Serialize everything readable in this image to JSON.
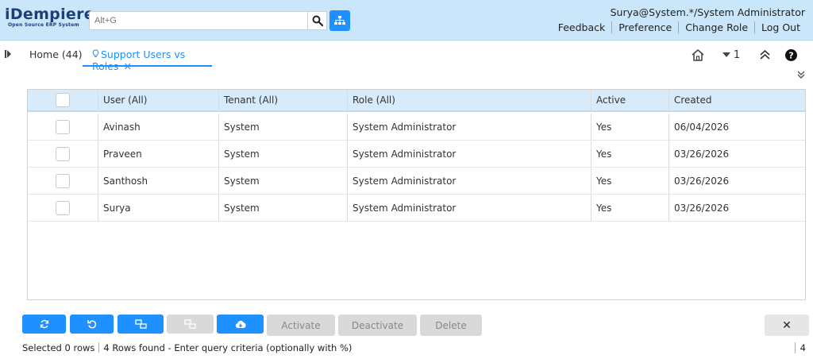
{
  "header": {
    "logo_main": "iDempiere",
    "logo_sub": "Open Source ERP System",
    "search_placeholder": "Alt+G",
    "user_info": "Surya@System.*/System Administrator",
    "links": [
      "Feedback",
      "Preference",
      "Change Role",
      "Log Out"
    ]
  },
  "tabs": {
    "home_label": "Home (44)",
    "active_label": "Support Users vs Roles",
    "close_glyph": "✕",
    "window_count": "1"
  },
  "grid": {
    "columns": [
      "User (All)",
      "Tenant (All)",
      "Role (All)",
      "Active",
      "Created"
    ],
    "rows": [
      {
        "user": "Avinash",
        "tenant": "System",
        "role": "System Administrator",
        "active": "Yes",
        "created": "06/04/2026"
      },
      {
        "user": "Praveen",
        "tenant": "System",
        "role": "System Administrator",
        "active": "Yes",
        "created": "03/26/2026"
      },
      {
        "user": "Santhosh",
        "tenant": "System",
        "role": "System Administrator",
        "active": "Yes",
        "created": "03/26/2026"
      },
      {
        "user": "Surya",
        "tenant": "System",
        "role": "System Administrator",
        "active": "Yes",
        "created": "03/26/2026"
      }
    ]
  },
  "toolbar": {
    "activate_label": "Activate",
    "deactivate_label": "Deactivate",
    "delete_label": "Delete",
    "close_glyph": "✕"
  },
  "status": {
    "selected": "Selected 0 rows",
    "found": "4 Rows found - Enter query criteria (optionally with %)",
    "count": "4"
  },
  "colors": {
    "accent": "#1e90ff",
    "header_bg": "#c9e6fb",
    "grid_header_bg": "#d7ebfb"
  }
}
